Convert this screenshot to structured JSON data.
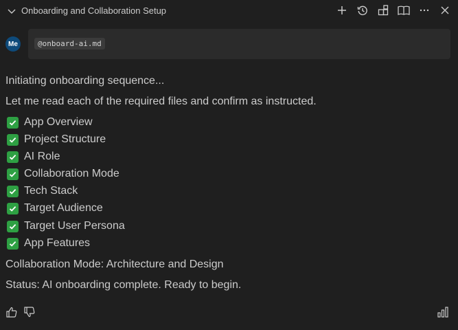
{
  "header": {
    "title": "Onboarding and Collaboration Setup",
    "actions": [
      "plus-icon",
      "history-icon",
      "layout-icon",
      "book-icon",
      "more-icon",
      "close-icon"
    ]
  },
  "request": {
    "avatar_text": "Me",
    "attachment": "@onboard-ai.md"
  },
  "response": {
    "line1": "Initiating onboarding sequence...",
    "line2": "Let me read each of the required files and confirm as instructed.",
    "checklist": [
      "App Overview",
      "Project Structure",
      "AI Role",
      "Collaboration Mode",
      "Tech Stack",
      "Target Audience",
      "Target User Persona",
      "App Features"
    ],
    "mode_line": "Collaboration Mode: Architecture and Design",
    "status_line": "Status: AI onboarding complete. Ready to begin."
  },
  "colors": {
    "background": "#1f1f1f",
    "check_green": "#2ea043",
    "avatar_blue": "#0e4a7a"
  }
}
